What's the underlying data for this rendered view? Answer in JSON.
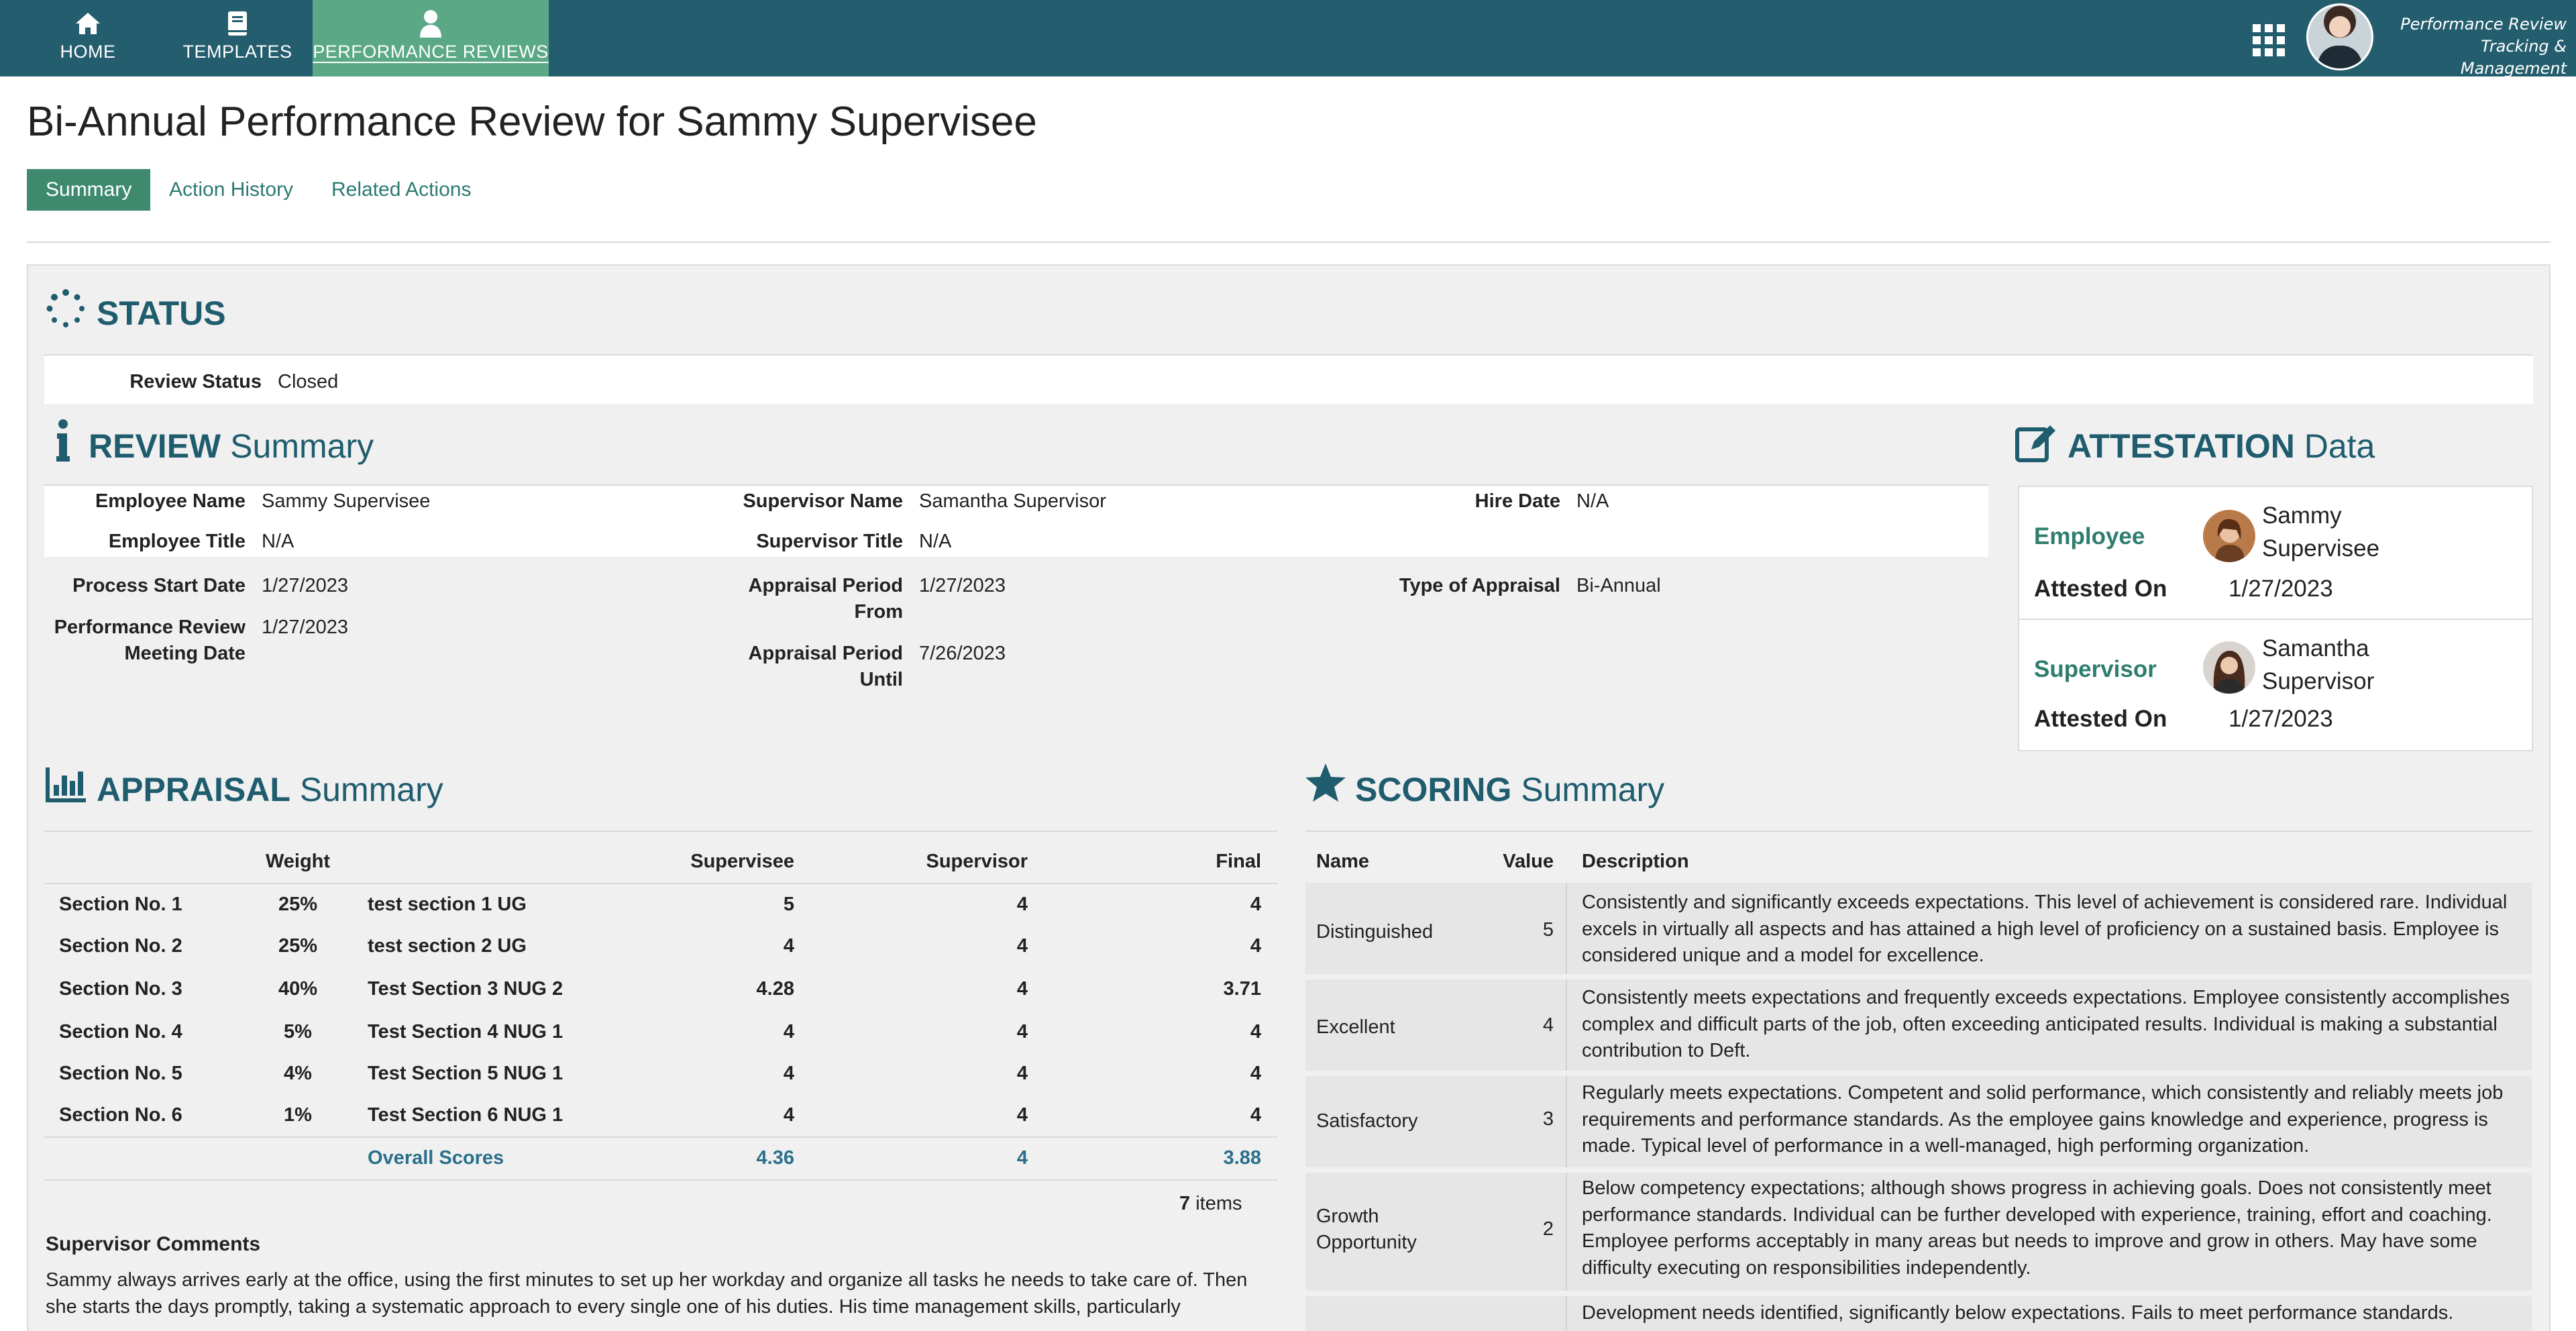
{
  "nav": {
    "tabs": [
      {
        "label": "HOME",
        "icon": "home-icon"
      },
      {
        "label": "TEMPLATES",
        "icon": "book-icon"
      },
      {
        "label": "PERFORMANCE REVIEWS",
        "icon": "user-icon",
        "active": true
      }
    ],
    "app_title_line1": "Performance Review",
    "app_title_line2": "Tracking & Management"
  },
  "page": {
    "title": "Bi-Annual Performance Review for Sammy Supervisee",
    "subtabs": [
      "Summary",
      "Action History",
      "Related Actions"
    ]
  },
  "status": {
    "heading_bold": "STATUS",
    "review_status_label": "Review Status",
    "review_status_value": "Closed"
  },
  "review": {
    "heading_bold": "REVIEW",
    "heading_light": "Summary",
    "employee_name_label": "Employee Name",
    "employee_name": "Sammy Supervisee",
    "employee_title_label": "Employee Title",
    "employee_title": "N/A",
    "supervisor_name_label": "Supervisor Name",
    "supervisor_name": "Samantha Supervisor",
    "supervisor_title_label": "Supervisor Title",
    "supervisor_title": "N/A",
    "hire_date_label": "Hire Date",
    "hire_date": "N/A",
    "process_start_label": "Process Start Date",
    "process_start": "1/27/2023",
    "meeting_label_1": "Performance Review",
    "meeting_label_2": "Meeting Date",
    "meeting_date": "1/27/2023",
    "period_from_label_1": "Appraisal Period",
    "period_from_label_2": "From",
    "period_from": "1/27/2023",
    "period_until_label_1": "Appraisal Period",
    "period_until_label_2": "Until",
    "period_until": "7/26/2023",
    "type_label": "Type of Appraisal",
    "type": "Bi-Annual"
  },
  "attestation": {
    "heading_bold": "ATTESTATION",
    "heading_light": "Data",
    "employee_role": "Employee",
    "employee_name_1": "Sammy",
    "employee_name_2": "Supervisee",
    "employee_attested_label": "Attested On",
    "employee_attested": "1/27/2023",
    "supervisor_role": "Supervisor",
    "supervisor_name_1": "Samantha",
    "supervisor_name_2": "Supervisor",
    "supervisor_attested_label": "Attested On",
    "supervisor_attested": "1/27/2023"
  },
  "appraisal": {
    "heading_bold": "APPRAISAL",
    "heading_light": "Summary",
    "headers": {
      "weight": "Weight",
      "supervisee": "Supervisee",
      "supervisor": "Supervisor",
      "final": "Final"
    },
    "rows": [
      {
        "section": "Section No. 1",
        "weight": "25%",
        "name": "test section 1 UG",
        "supervisee": "5",
        "supervisor": "4",
        "final": "4"
      },
      {
        "section": "Section No. 2",
        "weight": "25%",
        "name": "test section 2 UG",
        "supervisee": "4",
        "supervisor": "4",
        "final": "4"
      },
      {
        "section": "Section No. 3",
        "weight": "40%",
        "name": "Test Section 3 NUG 2",
        "supervisee": "4.28",
        "supervisor": "4",
        "final": "3.71"
      },
      {
        "section": "Section No. 4",
        "weight": "5%",
        "name": "Test Section 4 NUG 1",
        "supervisee": "4",
        "supervisor": "4",
        "final": "4"
      },
      {
        "section": "Section No. 5",
        "weight": "4%",
        "name": "Test Section 5 NUG 1",
        "supervisee": "4",
        "supervisor": "4",
        "final": "4"
      },
      {
        "section": "Section No. 6",
        "weight": "1%",
        "name": "Test Section 6 NUG 1",
        "supervisee": "4",
        "supervisor": "4",
        "final": "4"
      }
    ],
    "overall": {
      "label": "Overall Scores",
      "supervisee": "4.36",
      "supervisor": "4",
      "final": "3.88"
    },
    "items_count": "7",
    "items_label": "items",
    "comments_title": "Supervisor Comments",
    "comments_text": "Sammy always arrives early at the office, using the first minutes to set up her workday and organize all tasks he needs to take care of. Then she starts the days promptly, taking a systematic approach to every single one of his duties. His time management skills, particularly"
  },
  "scoring": {
    "heading_bold": "SCORING",
    "heading_light": "Summary",
    "headers": {
      "name": "Name",
      "value": "Value",
      "description": "Description"
    },
    "rows": [
      {
        "name": "Distinguished",
        "value": "5",
        "desc": "Consistently and significantly exceeds expectations. This level of achievement is considered rare. Individual excels in virtually all aspects and has attained a high level of proficiency on a sustained basis. Employee is considered unique and a model for excellence."
      },
      {
        "name": "Excellent",
        "value": "4",
        "desc": "Consistently meets expectations and frequently exceeds expectations. Employee consistently accomplishes complex and difficult parts of the job, often exceeding anticipated results. Individual is making a substantial contribution to Deft."
      },
      {
        "name": "Satisfactory",
        "value": "3",
        "desc": "Regularly meets expectations. Competent and solid performance, which consistently and reliably meets job requirements and performance standards. As the employee gains knowledge and experience, progress is made. Typical level of performance in a well-managed, high performing organization."
      },
      {
        "name_1": "Growth",
        "name_2": "Opportunity",
        "value": "2",
        "desc": "Below competency expectations; although shows progress in achieving goals. Does not consistently meet performance standards. Individual can be further developed with experience, training, effort and coaching. Employee performs acceptably in many areas but needs to improve and grow in others. May have some difficulty executing on responsibilities independently."
      },
      {
        "desc": "Development needs identified, significantly below expectations. Fails to meet performance standards."
      }
    ]
  }
}
